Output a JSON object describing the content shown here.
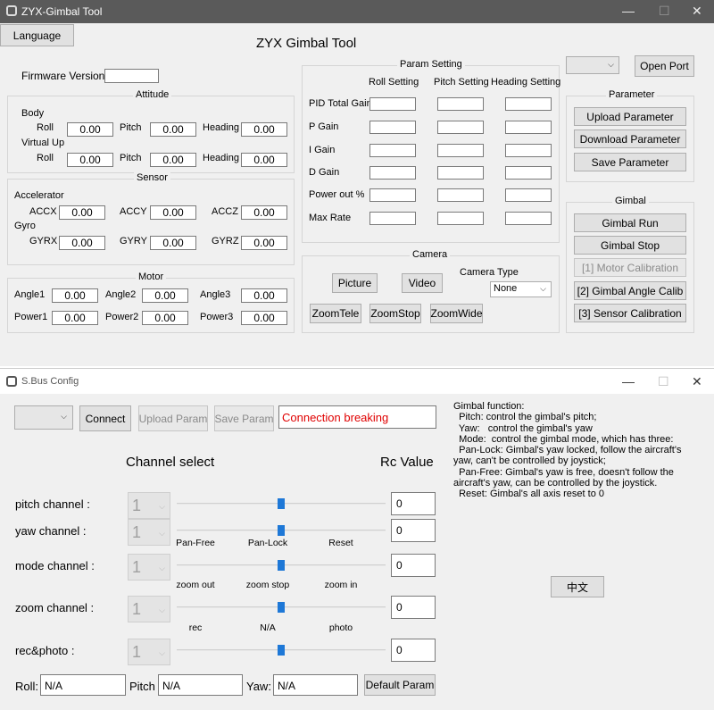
{
  "main_window": {
    "title": "ZYX-Gimbal Tool",
    "language_button": "Language",
    "app_title": "ZYX Gimbal Tool",
    "firmware_label": "Firmware Version",
    "firmware_value": "",
    "attitude": {
      "title": "Attitude",
      "body_label": "Body",
      "virtual_label": "Virtual Up",
      "roll_label": "Roll",
      "pitch_label": "Pitch",
      "heading_label": "Heading",
      "body_roll": "0.00",
      "body_pitch": "0.00",
      "body_heading": "0.00",
      "virt_roll": "0.00",
      "virt_pitch": "0.00",
      "virt_heading": "0.00"
    },
    "sensor": {
      "title": "Sensor",
      "acc_label": "Accelerator",
      "gyro_label": "Gyro",
      "accx_label": "ACCX",
      "accy_label": "ACCY",
      "accz_label": "ACCZ",
      "gyrx_label": "GYRX",
      "gyry_label": "GYRY",
      "gyrz_label": "GYRZ",
      "accx": "0.00",
      "accy": "0.00",
      "accz": "0.00",
      "gyrx": "0.00",
      "gyry": "0.00",
      "gyrz": "0.00"
    },
    "motor": {
      "title": "Motor",
      "angle1_label": "Angle1",
      "angle2_label": "Angle2",
      "angle3_label": "Angle3",
      "power1_label": "Power1",
      "power2_label": "Power2",
      "power3_label": "Power3",
      "angle1": "0.00",
      "angle2": "0.00",
      "angle3": "0.00",
      "power1": "0.00",
      "power2": "0.00",
      "power3": "0.00"
    },
    "param_setting": {
      "title": "Param Setting",
      "col_roll": "Roll Setting",
      "col_pitch": "Pitch Setting",
      "col_heading": "Heading Setting",
      "rows": [
        "PID Total Gain",
        "P Gain",
        "I Gain",
        "D Gain",
        "Power out %",
        "Max Rate"
      ]
    },
    "camera": {
      "title": "Camera",
      "picture": "Picture",
      "video": "Video",
      "type_label": "Camera Type",
      "type_value": "None",
      "zoom_tele": "ZoomTele",
      "zoom_stop": "ZoomStop",
      "zoom_wide": "ZoomWide"
    },
    "port": {
      "selected": "",
      "open_port": "Open Port"
    },
    "parameter": {
      "title": "Parameter",
      "upload": "Upload Parameter",
      "download": "Download Parameter",
      "save": "Save Parameter"
    },
    "gimbal": {
      "title": "Gimbal",
      "run": "Gimbal Run",
      "stop": "Gimbal Stop",
      "motor_cal": "[1] Motor Calibration",
      "angle_cal": "[2] Gimbal Angle Calib",
      "sensor_cal": "[3] Sensor Calibration"
    }
  },
  "sbus_window": {
    "title": "S.Bus Config",
    "port_selected": "",
    "connect": "Connect",
    "upload_param": "Upload Param",
    "save_param": "Save Param",
    "status": "Connection breaking",
    "status_color": "#e00000",
    "channel_select_label": "Channel select",
    "rc_value_label": "Rc Value",
    "channels": [
      {
        "label": "pitch channel :",
        "value": "1",
        "rc": "0",
        "ticks": []
      },
      {
        "label": "yaw channel :",
        "value": "1",
        "rc": "0",
        "ticks": []
      },
      {
        "label": "mode channel :",
        "value": "1",
        "rc": "0",
        "ticks": [
          "Pan-Free",
          "Pan-Lock",
          "Reset"
        ]
      },
      {
        "label": "zoom channel :",
        "value": "1",
        "rc": "0",
        "ticks": [
          "zoom out",
          "zoom stop",
          "zoom in"
        ]
      },
      {
        "label": "rec&photo :",
        "value": "1",
        "rc": "0",
        "ticks": [
          "rec",
          "N/A",
          "photo"
        ]
      }
    ],
    "roll_label": "Roll:",
    "pitch_label": "Pitch",
    "yaw_label": "Yaw:",
    "roll_value": "N/A",
    "pitch_value": "N/A",
    "yaw_value": "N/A",
    "default_param": "Default Param",
    "help_lines": [
      "Gimbal function:",
      "  Pitch: control the gimbal's pitch;",
      "  Yaw:   control the gimbal's yaw",
      "  Mode:  control the gimbal mode, which has three:",
      "  Pan-Lock: Gimbal's yaw locked, follow the aircraft's",
      "yaw, can't be controlled by joystick;",
      "  Pan-Free: Gimbal's yaw is free, doesn't follow the",
      "aircraft's yaw, can be controlled by the joystick.",
      "  Reset: Gimbal's all axis reset to 0"
    ],
    "chinese_button": "中文"
  }
}
